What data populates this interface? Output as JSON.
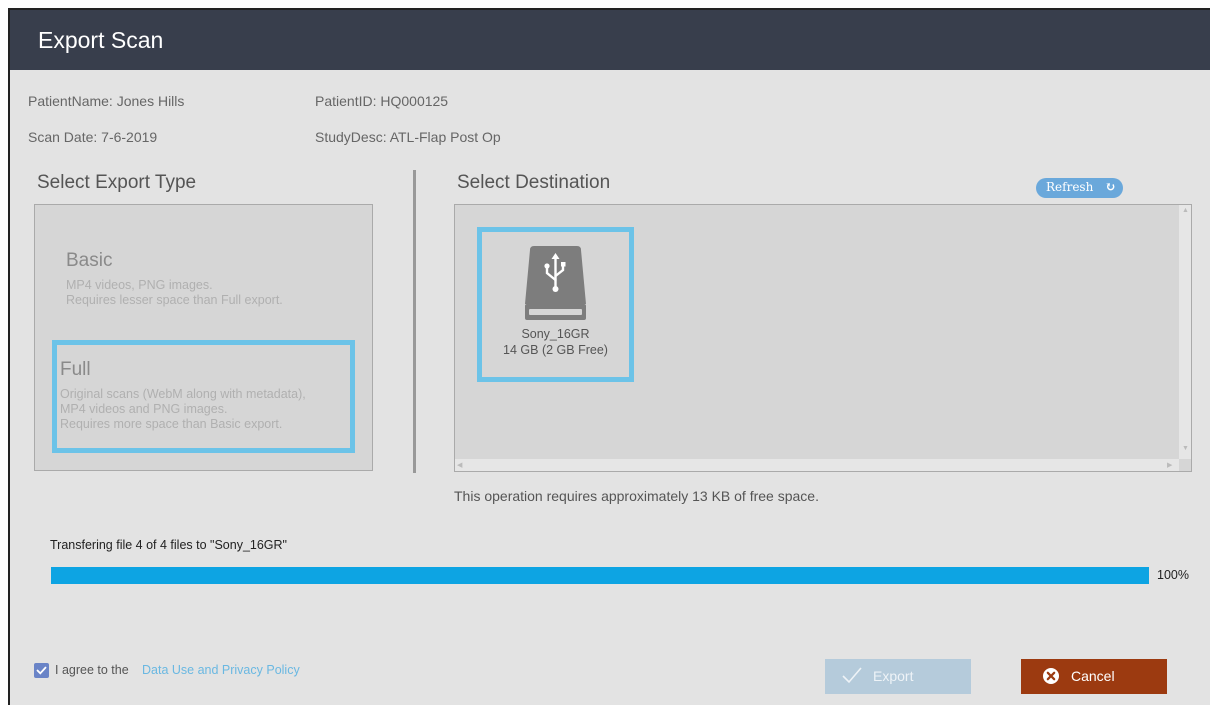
{
  "dialog": {
    "title": "Export Scan"
  },
  "patient": {
    "name": "PatientName: Jones Hills",
    "id": "PatientID: HQ000125",
    "scan_date": "Scan Date: 7-6-2019",
    "study_desc": "StudyDesc: ATL-Flap Post Op"
  },
  "export_type": {
    "title": "Select Export Type",
    "selected": "Full",
    "options": [
      {
        "name": "Basic",
        "desc_lines": [
          "MP4 videos, PNG images.",
          "Requires lesser space than Full export."
        ]
      },
      {
        "name": "Full",
        "desc_lines": [
          "Original scans (WebM along with metadata),",
          "MP4 videos and PNG images.",
          "Requires more space than Basic export."
        ]
      }
    ]
  },
  "destination": {
    "title": "Select Destination",
    "refresh_label": "Refresh",
    "drives": [
      {
        "name": "Sony_16GR",
        "size": "14 GB (2 GB Free)",
        "icon": "usb-drive-icon"
      }
    ],
    "space_note": "This operation requires approximately 13 KB of free space."
  },
  "progress": {
    "label": "Transfering file 4 of 4 files to \"Sony_16GR\"",
    "value": 1.0,
    "percent_text": "100%",
    "color": "#0da4e3"
  },
  "footer": {
    "agree_checked": true,
    "agree_text": "I agree to the",
    "policy_link": "Data Use and Privacy Policy",
    "export_label": "Export",
    "cancel_label": "Cancel"
  },
  "colors": {
    "titlebar": "#383e4c",
    "selection_border": "#6cc3e8",
    "cancel_bg": "#9c3a10",
    "export_disabled_bg": "#b5cbdb"
  }
}
